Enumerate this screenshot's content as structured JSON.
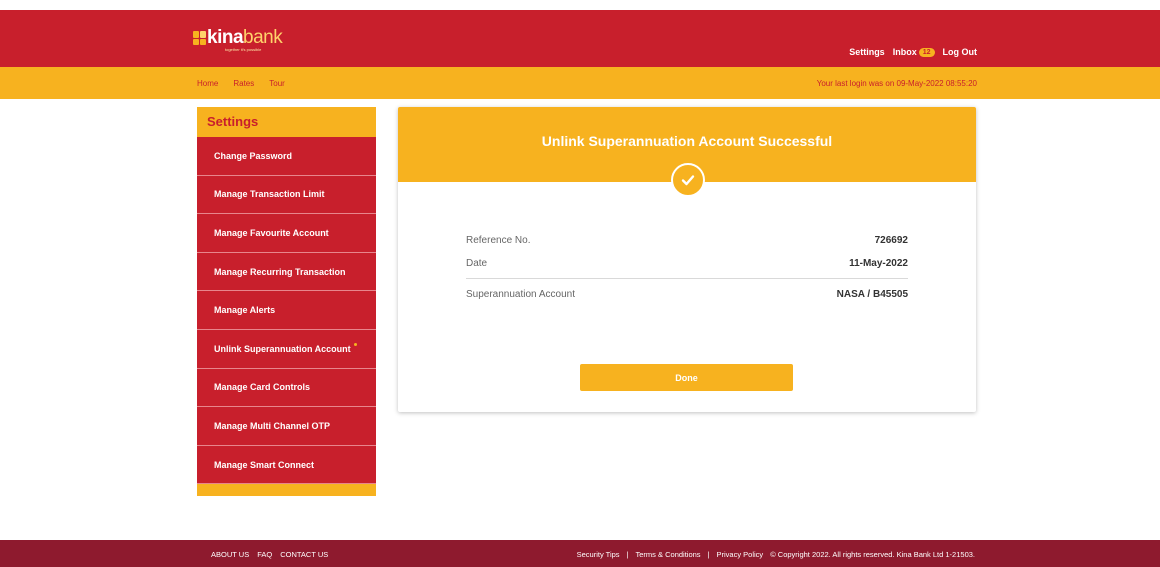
{
  "brand": {
    "logo_main": "kina",
    "logo_accent": "bank",
    "tagline": "together it's possible"
  },
  "header": {
    "links": {
      "settings": "Settings",
      "inbox": "Inbox",
      "inbox_count": "12",
      "logout": "Log Out"
    }
  },
  "nav": {
    "items": [
      "Home",
      "Rates",
      "Tour"
    ],
    "last_login": "Your last login was on 09-May-2022 08:55:20"
  },
  "sidebar": {
    "title": "Settings",
    "items": [
      {
        "label": "Change Password"
      },
      {
        "label": "Manage Transaction Limit"
      },
      {
        "label": "Manage Favourite Account"
      },
      {
        "label": "Manage Recurring Transaction"
      },
      {
        "label": "Manage Alerts"
      },
      {
        "label": "Unlink Superannuation Account"
      },
      {
        "label": "Manage Card Controls"
      },
      {
        "label": "Manage Multi Channel OTP"
      },
      {
        "label": "Manage Smart Connect"
      }
    ]
  },
  "result": {
    "title": "Unlink Superannuation Account Successful",
    "icon": "check-icon",
    "rows": [
      {
        "label": "Reference No.",
        "value": "726692"
      },
      {
        "label": "Date",
        "value": "11-May-2022"
      },
      {
        "label": "Superannuation Account",
        "value": "NASA / B45505"
      }
    ],
    "done_label": "Done"
  },
  "footer": {
    "left_links": [
      "ABOUT US",
      "FAQ",
      "CONTACT US"
    ],
    "security_tips": "Security Tips",
    "sep": "|",
    "terms": "Terms & Conditions",
    "privacy": "Privacy Policy",
    "copyright": "© Copyright 2022. All rights reserved. Kina Bank Ltd 1-21503."
  },
  "colors": {
    "brand_red": "#c81f2c",
    "brand_yellow": "#f7b21f",
    "footer_maroon": "#8e1a2e"
  }
}
